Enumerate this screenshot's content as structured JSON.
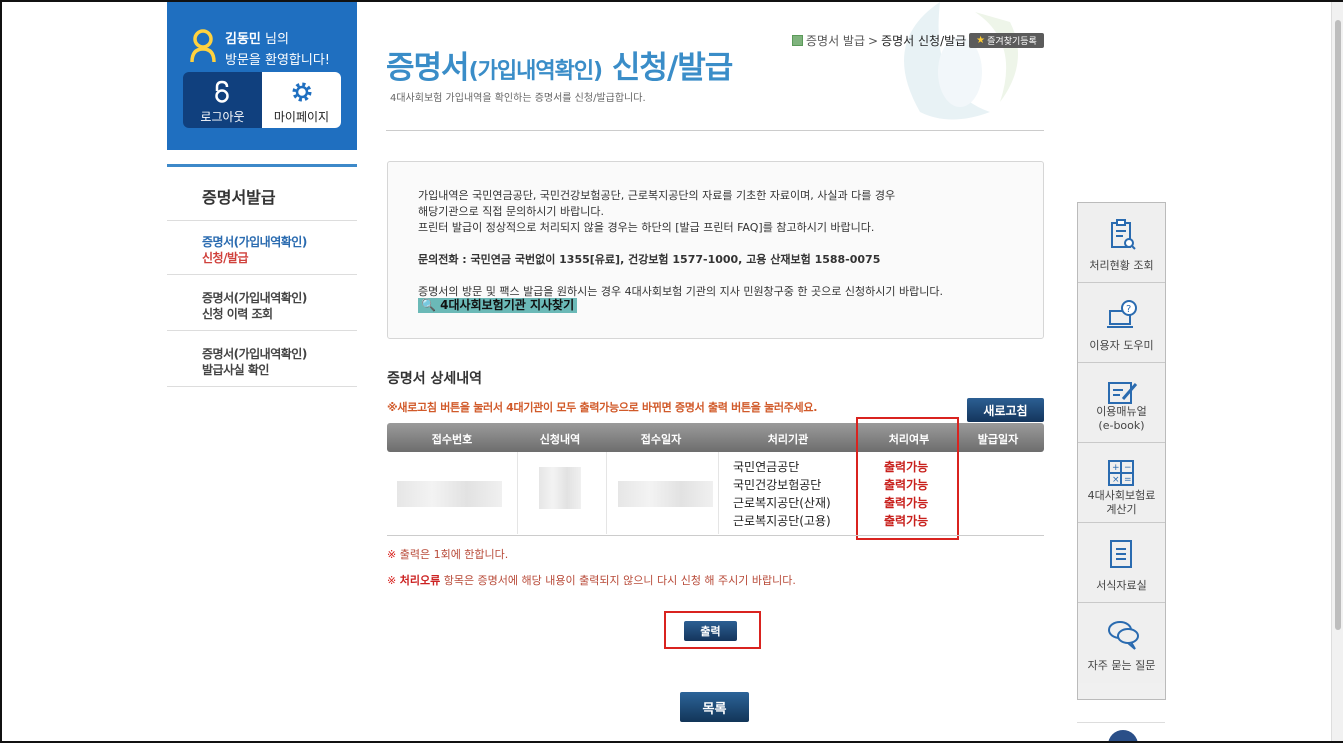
{
  "user": {
    "name": "김동민",
    "honorific": " 님의",
    "welcome": "방문을 환영합니다!",
    "logout_label": "로그아웃",
    "mypage_label": "마이페이지"
  },
  "sidebar": {
    "title": "증명서발급",
    "items": [
      {
        "line1": "증명서(가입내역확인)",
        "line2": "신청/발급"
      },
      {
        "line1": "증명서(가입내역확인)",
        "line2": "신청 이력 조회"
      },
      {
        "line1": "증명서(가입내역확인)",
        "line2": "발급사실 확인"
      }
    ]
  },
  "header": {
    "title_a": "증명서",
    "title_b": "(가입내역확인)",
    "title_c": " 신청/발급",
    "subtitle": "4대사회보험 가입내역을 확인하는 증명서를 신청/발급합니다.",
    "breadcrumb_parent": "증명서 발급",
    "breadcrumb_sep": ">",
    "breadcrumb_current": "증명서 신청/발급",
    "bookmark_label": "즐겨찾기등록"
  },
  "notice": {
    "line1": "가입내역은 국민연금공단, 국민건강보험공단, 근로복지공단의 자료를 기초한 자료이며, 사실과 다를 경우",
    "line2": "해당기관으로 직접 문의하시기 바랍니다.",
    "line3": "프린터 발급이 정상적으로 처리되지 않을 경우는 하단의 [발급 프린터 FAQ]를 참고하시기 바랍니다.",
    "phone": "문의전화 : 국민연금 국번없이 1355[유료], 건강보험 1577-1000, 고용 산재보험 1588-0075",
    "line4": "증명서의 방문 및 팩스 발급을 원하시는 경우 4대사회보험 기관의 지사 민원창구중 한 곳으로 신청하시기 바랍니다.",
    "link": "4대사회보험기관 지사찾기"
  },
  "detail": {
    "title": "증명서 상세내역",
    "warning": "※새로고침 버튼을 눌러서 4대기관이 모두 출력가능으로 바뀌면 증명서 출력 버튼을 눌러주세요.",
    "refresh_label": "새로고침",
    "columns": [
      "접수번호",
      "신청내역",
      "접수일자",
      "처리기관",
      "처리여부",
      "발급일자"
    ],
    "rows": [
      {
        "org": "국민연금공단",
        "status": "출력가능"
      },
      {
        "org": "국민건강보험공단",
        "status": "출력가능"
      },
      {
        "org": "근로복지공단(산재)",
        "status": "출력가능"
      },
      {
        "org": "근로복지공단(고용)",
        "status": "출력가능"
      }
    ],
    "note1": "출력은 1회에 한합니다.",
    "note_mark": "※",
    "note2_bold": "처리오류",
    "note2_rest": " 항목은 증명서에 해당 내용이 출력되지 않으니 다시 신청 해 주시기 바랍니다.",
    "print_label": "출력",
    "list_label": "목록"
  },
  "quick_menu": [
    {
      "lines": [
        "처리현황 조회"
      ],
      "icon": "clipboard-search-icon"
    },
    {
      "lines": [
        "이용자 도우미"
      ],
      "icon": "laptop-help-icon"
    },
    {
      "lines": [
        "이용매뉴얼",
        "(e-book)"
      ],
      "icon": "manual-edit-icon"
    },
    {
      "lines": [
        "4대사회보험료",
        "계산기"
      ],
      "icon": "calculator-icon"
    },
    {
      "lines": [
        "서식자료실"
      ],
      "icon": "document-icon"
    },
    {
      "lines": [
        "자주 묻는 질문"
      ],
      "icon": "chat-bubbles-icon"
    }
  ],
  "colors": {
    "brand_blue": "#1f6fc0",
    "title_blue": "#3a8dc8",
    "status_red": "#c8201c",
    "button_navy": "#14355c"
  }
}
